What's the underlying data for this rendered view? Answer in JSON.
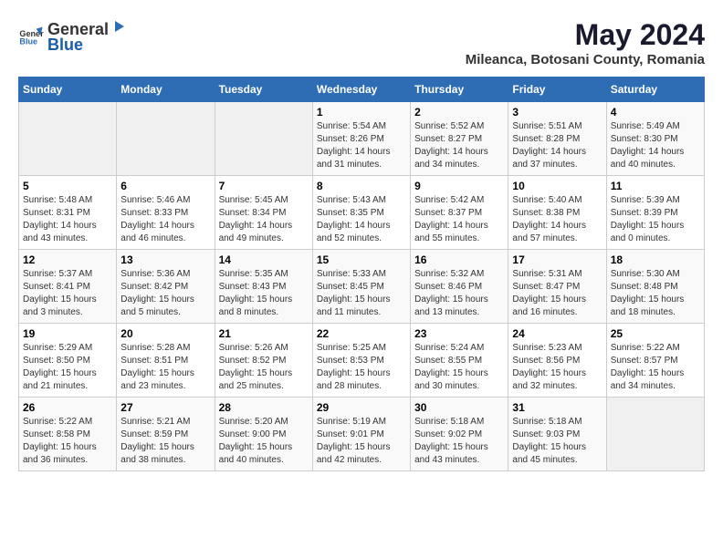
{
  "logo": {
    "general": "General",
    "blue": "Blue"
  },
  "title": "May 2024",
  "subtitle": "Mileanca, Botosani County, Romania",
  "days_of_week": [
    "Sunday",
    "Monday",
    "Tuesday",
    "Wednesday",
    "Thursday",
    "Friday",
    "Saturday"
  ],
  "weeks": [
    [
      {
        "day": "",
        "empty": true
      },
      {
        "day": "",
        "empty": true
      },
      {
        "day": "",
        "empty": true
      },
      {
        "day": "1",
        "sunrise": "5:54 AM",
        "sunset": "8:26 PM",
        "daylight": "14 hours and 31 minutes."
      },
      {
        "day": "2",
        "sunrise": "5:52 AM",
        "sunset": "8:27 PM",
        "daylight": "14 hours and 34 minutes."
      },
      {
        "day": "3",
        "sunrise": "5:51 AM",
        "sunset": "8:28 PM",
        "daylight": "14 hours and 37 minutes."
      },
      {
        "day": "4",
        "sunrise": "5:49 AM",
        "sunset": "8:30 PM",
        "daylight": "14 hours and 40 minutes."
      }
    ],
    [
      {
        "day": "5",
        "sunrise": "5:48 AM",
        "sunset": "8:31 PM",
        "daylight": "14 hours and 43 minutes."
      },
      {
        "day": "6",
        "sunrise": "5:46 AM",
        "sunset": "8:33 PM",
        "daylight": "14 hours and 46 minutes."
      },
      {
        "day": "7",
        "sunrise": "5:45 AM",
        "sunset": "8:34 PM",
        "daylight": "14 hours and 49 minutes."
      },
      {
        "day": "8",
        "sunrise": "5:43 AM",
        "sunset": "8:35 PM",
        "daylight": "14 hours and 52 minutes."
      },
      {
        "day": "9",
        "sunrise": "5:42 AM",
        "sunset": "8:37 PM",
        "daylight": "14 hours and 55 minutes."
      },
      {
        "day": "10",
        "sunrise": "5:40 AM",
        "sunset": "8:38 PM",
        "daylight": "14 hours and 57 minutes."
      },
      {
        "day": "11",
        "sunrise": "5:39 AM",
        "sunset": "8:39 PM",
        "daylight": "15 hours and 0 minutes."
      }
    ],
    [
      {
        "day": "12",
        "sunrise": "5:37 AM",
        "sunset": "8:41 PM",
        "daylight": "15 hours and 3 minutes."
      },
      {
        "day": "13",
        "sunrise": "5:36 AM",
        "sunset": "8:42 PM",
        "daylight": "15 hours and 5 minutes."
      },
      {
        "day": "14",
        "sunrise": "5:35 AM",
        "sunset": "8:43 PM",
        "daylight": "15 hours and 8 minutes."
      },
      {
        "day": "15",
        "sunrise": "5:33 AM",
        "sunset": "8:45 PM",
        "daylight": "15 hours and 11 minutes."
      },
      {
        "day": "16",
        "sunrise": "5:32 AM",
        "sunset": "8:46 PM",
        "daylight": "15 hours and 13 minutes."
      },
      {
        "day": "17",
        "sunrise": "5:31 AM",
        "sunset": "8:47 PM",
        "daylight": "15 hours and 16 minutes."
      },
      {
        "day": "18",
        "sunrise": "5:30 AM",
        "sunset": "8:48 PM",
        "daylight": "15 hours and 18 minutes."
      }
    ],
    [
      {
        "day": "19",
        "sunrise": "5:29 AM",
        "sunset": "8:50 PM",
        "daylight": "15 hours and 21 minutes."
      },
      {
        "day": "20",
        "sunrise": "5:28 AM",
        "sunset": "8:51 PM",
        "daylight": "15 hours and 23 minutes."
      },
      {
        "day": "21",
        "sunrise": "5:26 AM",
        "sunset": "8:52 PM",
        "daylight": "15 hours and 25 minutes."
      },
      {
        "day": "22",
        "sunrise": "5:25 AM",
        "sunset": "8:53 PM",
        "daylight": "15 hours and 28 minutes."
      },
      {
        "day": "23",
        "sunrise": "5:24 AM",
        "sunset": "8:55 PM",
        "daylight": "15 hours and 30 minutes."
      },
      {
        "day": "24",
        "sunrise": "5:23 AM",
        "sunset": "8:56 PM",
        "daylight": "15 hours and 32 minutes."
      },
      {
        "day": "25",
        "sunrise": "5:22 AM",
        "sunset": "8:57 PM",
        "daylight": "15 hours and 34 minutes."
      }
    ],
    [
      {
        "day": "26",
        "sunrise": "5:22 AM",
        "sunset": "8:58 PM",
        "daylight": "15 hours and 36 minutes."
      },
      {
        "day": "27",
        "sunrise": "5:21 AM",
        "sunset": "8:59 PM",
        "daylight": "15 hours and 38 minutes."
      },
      {
        "day": "28",
        "sunrise": "5:20 AM",
        "sunset": "9:00 PM",
        "daylight": "15 hours and 40 minutes."
      },
      {
        "day": "29",
        "sunrise": "5:19 AM",
        "sunset": "9:01 PM",
        "daylight": "15 hours and 42 minutes."
      },
      {
        "day": "30",
        "sunrise": "5:18 AM",
        "sunset": "9:02 PM",
        "daylight": "15 hours and 43 minutes."
      },
      {
        "day": "31",
        "sunrise": "5:18 AM",
        "sunset": "9:03 PM",
        "daylight": "15 hours and 45 minutes."
      },
      {
        "day": "",
        "empty": true
      }
    ]
  ]
}
